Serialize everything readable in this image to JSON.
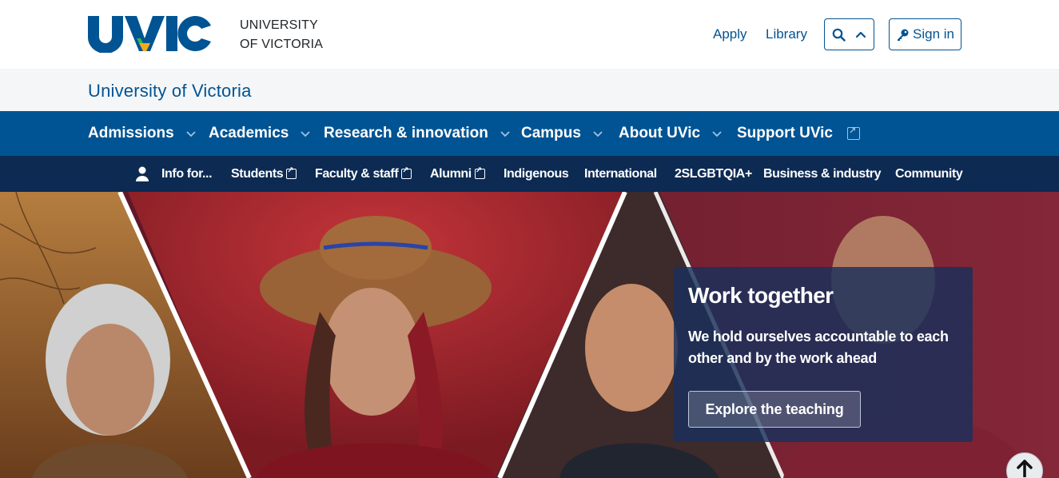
{
  "header": {
    "logo_text": "UVIC",
    "university_line1": "UNIVERSITY",
    "university_line2": "OF VICTORIA",
    "apply_label": "Apply",
    "library_label": "Library",
    "search_icon": "search-icon",
    "chevron_icon": "chevron-up-icon",
    "signin_label": "Sign in",
    "signin_icon": "key-icon"
  },
  "site": {
    "title": "University of Victoria"
  },
  "nav": {
    "items": [
      {
        "label": "Admissions"
      },
      {
        "label": "Academics"
      },
      {
        "label": "Research & innovation"
      },
      {
        "label": "Campus"
      },
      {
        "label": "About UVic"
      },
      {
        "label": "Support UVic"
      }
    ]
  },
  "audience": {
    "info_label": "Info for...",
    "items": [
      {
        "label": "Students"
      },
      {
        "label": "Faculty & staff"
      },
      {
        "label": "Alumni"
      },
      {
        "label": "Indigenous"
      },
      {
        "label": "International"
      },
      {
        "label": "2SLGBTQIA+"
      },
      {
        "label": "Business & industry"
      },
      {
        "label": "Community"
      }
    ]
  },
  "hero": {
    "title": "Work together",
    "text": "We hold ourselves accountable to each other and by the work ahead",
    "button_label": "Explore the teaching"
  },
  "colors": {
    "brand_blue": "#005493",
    "navy": "#0c2a52",
    "gold": "#f5aa1c"
  }
}
